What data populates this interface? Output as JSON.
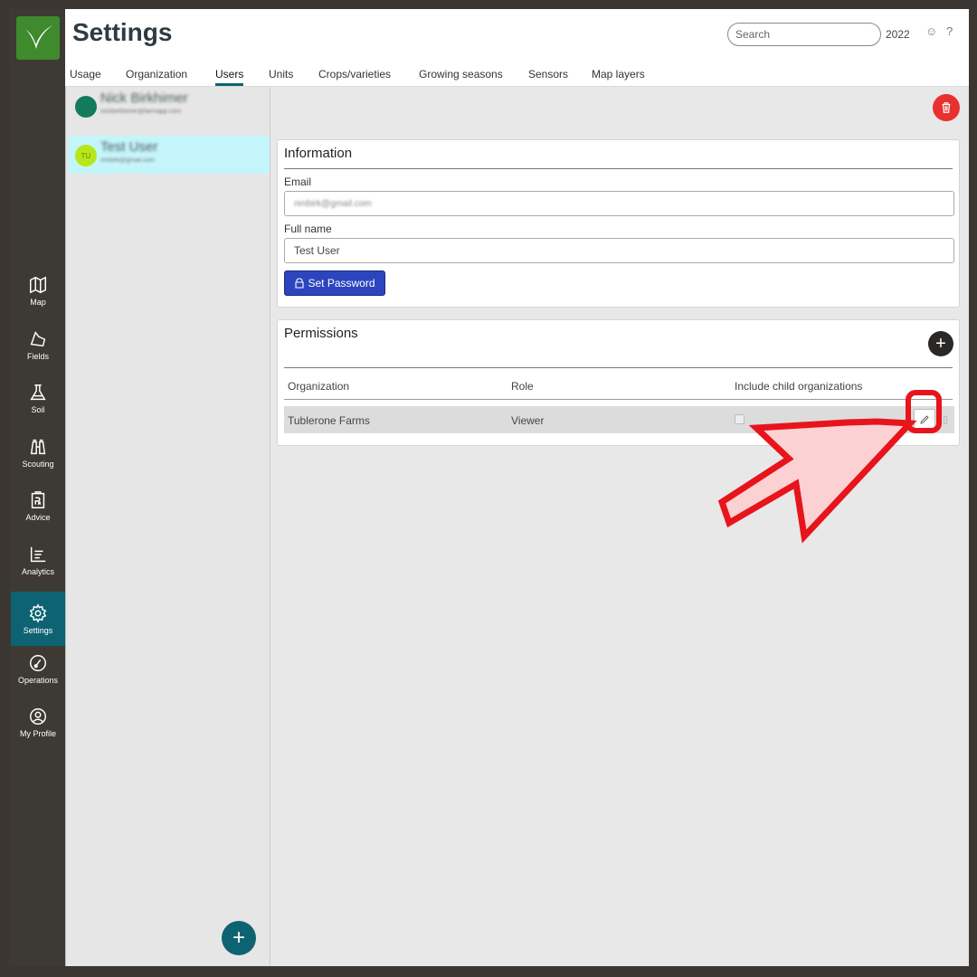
{
  "header": {
    "title": "Settings",
    "search_placeholder": "Search",
    "year": "2022",
    "help_glyph": "?"
  },
  "tabs": [
    {
      "label": "Usage"
    },
    {
      "label": "Organization"
    },
    {
      "label": "Users",
      "active": true
    },
    {
      "label": "Units"
    },
    {
      "label": "Crops/varieties"
    },
    {
      "label": "Growing seasons"
    },
    {
      "label": "Sensors"
    },
    {
      "label": "Map layers"
    }
  ],
  "nav": [
    {
      "label": "Map",
      "icon": "map-icon"
    },
    {
      "label": "Fields",
      "icon": "fields-icon"
    },
    {
      "label": "Soil",
      "icon": "flask-icon"
    },
    {
      "label": "Scouting",
      "icon": "binoculars-icon"
    },
    {
      "label": "Advice",
      "icon": "prescription-icon"
    },
    {
      "label": "Analytics",
      "icon": "chart-icon"
    },
    {
      "label": "Settings",
      "icon": "gear-icon",
      "active": true
    },
    {
      "label": "Operations",
      "icon": "gauge-icon"
    },
    {
      "label": "My Profile",
      "icon": "profile-icon"
    }
  ],
  "users": [
    {
      "name": "Nick Birkhimer",
      "email": "nickbirkhimer@farmapp.com",
      "avatar_color": "#137a5c",
      "avatar_text": ""
    },
    {
      "name": "Test User",
      "email": "nmbirk@gmail.com",
      "avatar_color": "#b7e61a",
      "avatar_text": "TU",
      "selected": true
    }
  ],
  "information": {
    "title": "Information",
    "email_label": "Email",
    "email_value": "nmbirk@gmail.com",
    "fullname_label": "Full name",
    "fullname_value": "Test User",
    "set_password_label": "Set Password"
  },
  "permissions": {
    "title": "Permissions",
    "columns": [
      "Organization",
      "Role",
      "Include child organizations"
    ],
    "rows": [
      {
        "organization": "Tublerone Farms",
        "role": "Viewer",
        "include_children": false
      }
    ]
  },
  "colors": {
    "accent": "#0d6372",
    "delete": "#e8312f",
    "primary_button": "#2c45be",
    "annotation": "#e8141c"
  }
}
